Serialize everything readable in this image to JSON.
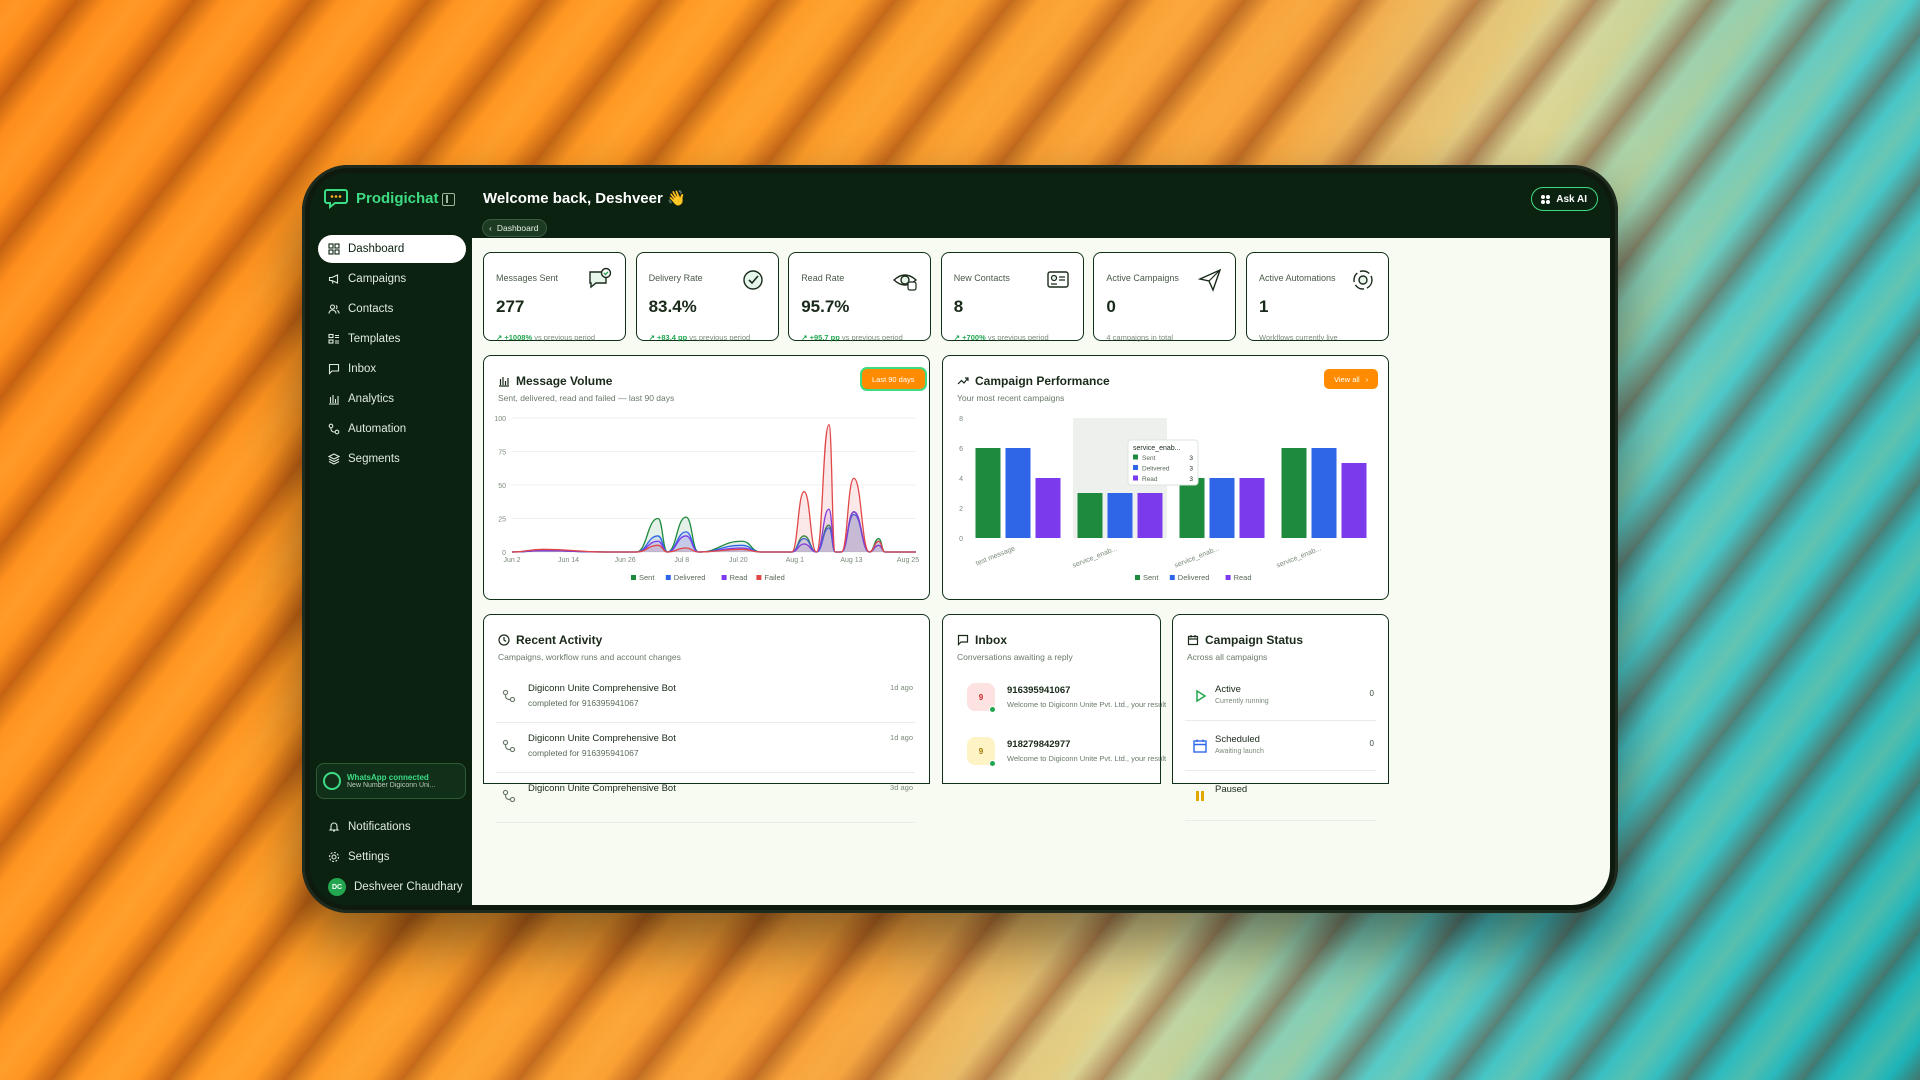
{
  "brand": {
    "name": "Prodigichat"
  },
  "header": {
    "welcome": "Welcome back, Deshveer",
    "wave": "👋",
    "ask_ai": "Ask AI"
  },
  "breadcrumb": {
    "label": "Dashboard"
  },
  "sidebar": {
    "items": [
      {
        "label": "Dashboard",
        "icon": "grid-icon",
        "active": true
      },
      {
        "label": "Campaigns",
        "icon": "megaphone-icon"
      },
      {
        "label": "Contacts",
        "icon": "users-icon"
      },
      {
        "label": "Templates",
        "icon": "template-icon"
      },
      {
        "label": "Inbox",
        "icon": "message-icon"
      },
      {
        "label": "Analytics",
        "icon": "bar-chart-icon"
      },
      {
        "label": "Automation",
        "icon": "workflow-icon"
      },
      {
        "label": "Segments",
        "icon": "layers-icon"
      }
    ],
    "whatsapp": {
      "title": "WhatsApp connected",
      "subtitle": "New Number Digiconn Uni..."
    },
    "notifications": "Notifications",
    "settings": "Settings",
    "user": {
      "name": "Deshveer Chaudhary",
      "initials": "DC"
    }
  },
  "kpis": [
    {
      "label": "Messages Sent",
      "value": "277",
      "delta": "+1008%",
      "suffix": "vs previous period",
      "icon": "message-check-icon"
    },
    {
      "label": "Delivery Rate",
      "value": "83.4%",
      "delta": "+83.4 pp",
      "suffix": "vs previous period",
      "icon": "check-circle-icon"
    },
    {
      "label": "Read Rate",
      "value": "95.7%",
      "delta": "+95.7 pp",
      "suffix": "vs previous period",
      "icon": "eye-icon"
    },
    {
      "label": "New Contacts",
      "value": "8",
      "delta": "+700%",
      "suffix": "vs previous period",
      "icon": "contact-card-icon"
    },
    {
      "label": "Active Campaigns",
      "value": "0",
      "delta": "",
      "suffix": "4 campaigns in total",
      "icon": "send-icon"
    },
    {
      "label": "Active Automations",
      "value": "1",
      "delta": "",
      "suffix": "Workflows currently live",
      "icon": "automation-icon"
    }
  ],
  "message_volume": {
    "title": "Message Volume",
    "subtitle": "Sent, delivered, read and failed — last 90 days",
    "range_button": "Last 90 days"
  },
  "campaign_performance": {
    "title": "Campaign Performance",
    "subtitle": "Your most recent campaigns",
    "view_all": "View all",
    "tooltip": {
      "title": "service_enab...",
      "rows": [
        {
          "name": "Sent",
          "value": "3"
        },
        {
          "name": "Delivered",
          "value": "3"
        },
        {
          "name": "Read",
          "value": "3"
        }
      ]
    }
  },
  "recent_activity": {
    "title": "Recent Activity",
    "subtitle": "Campaigns, workflow runs and account changes",
    "items": [
      {
        "title": "Digiconn Unite Comprehensive Bot",
        "desc": "completed for 916395941067",
        "time": "1d ago"
      },
      {
        "title": "Digiconn Unite Comprehensive Bot",
        "desc": "completed for 916395941067",
        "time": "1d ago"
      },
      {
        "title": "Digiconn Unite Comprehensive Bot",
        "desc": "",
        "time": "3d ago"
      }
    ]
  },
  "inbox": {
    "title": "Inbox",
    "subtitle": "Conversations awaiting a reply",
    "items": [
      {
        "number": "916395941067",
        "message": "Welcome to Digiconn Unite Pvt. Ltd., your result",
        "badge": "9",
        "bg": "#fde2e2",
        "fg": "#c62828"
      },
      {
        "number": "918279842977",
        "message": "Welcome to Digiconn Unite Pvt. Ltd., your result",
        "badge": "9",
        "bg": "#fdf3c4",
        "fg": "#a07800"
      }
    ]
  },
  "campaign_status": {
    "title": "Campaign Status",
    "subtitle": "Across all campaigns",
    "items": [
      {
        "title": "Active",
        "desc": "Currently running",
        "count": "0",
        "icon": "play-icon"
      },
      {
        "title": "Scheduled",
        "desc": "Awaiting launch",
        "count": "0",
        "icon": "calendar-icon"
      },
      {
        "title": "Paused",
        "desc": "",
        "count": "",
        "icon": "pause-icon"
      }
    ]
  },
  "colors": {
    "sent": "#1e8a3e",
    "delivered": "#2f66e8",
    "read": "#7c3aed",
    "failed": "#e04848",
    "accent": "#ff8c00",
    "brand": "#3ddc84"
  },
  "chart_data": [
    {
      "type": "line",
      "title": "Message Volume",
      "x_ticks": [
        "Jun 2",
        "Jun 14",
        "Jun 26",
        "Jul 8",
        "Jul 20",
        "Aug 1",
        "Aug 13",
        "Aug 25"
      ],
      "y_ticks": [
        "0",
        "25",
        "50",
        "75",
        "100"
      ],
      "ylim": [
        0,
        100
      ],
      "legend": [
        "Sent",
        "Delivered",
        "Read",
        "Failed"
      ],
      "series": [
        {
          "name": "Sent",
          "x_day": [
            0,
            10,
            30,
            40,
            47,
            50,
            56,
            60,
            74,
            80,
            90,
            94,
            98,
            102,
            104,
            106,
            110,
            115,
            118,
            120,
            130
          ],
          "values": [
            0,
            1,
            0,
            0,
            25,
            0,
            26,
            0,
            8,
            0,
            0,
            12,
            0,
            20,
            0,
            0,
            30,
            0,
            10,
            0,
            0
          ]
        },
        {
          "name": "Delivered",
          "x_day": [
            0,
            10,
            30,
            40,
            47,
            50,
            56,
            60,
            74,
            80,
            90,
            94,
            98,
            102,
            104,
            106,
            110,
            115,
            118,
            120,
            130
          ],
          "values": [
            0,
            1,
            0,
            0,
            12,
            0,
            15,
            0,
            5,
            0,
            0,
            10,
            0,
            18,
            0,
            0,
            28,
            0,
            8,
            0,
            0
          ]
        },
        {
          "name": "Read",
          "x_day": [
            0,
            10,
            30,
            40,
            47,
            50,
            56,
            60,
            74,
            80,
            90,
            94,
            98,
            102,
            104,
            106,
            110,
            115,
            118,
            120,
            130
          ],
          "values": [
            0,
            1,
            0,
            0,
            8,
            0,
            12,
            0,
            3,
            0,
            0,
            6,
            0,
            32,
            0,
            0,
            30,
            0,
            5,
            0,
            0
          ]
        },
        {
          "name": "Failed",
          "x_day": [
            0,
            10,
            30,
            40,
            47,
            50,
            56,
            60,
            74,
            80,
            90,
            94,
            98,
            102,
            104,
            106,
            110,
            115,
            118,
            120,
            130
          ],
          "values": [
            0,
            2,
            0,
            0,
            5,
            0,
            3,
            0,
            2,
            0,
            0,
            45,
            0,
            95,
            0,
            0,
            55,
            0,
            8,
            0,
            0
          ]
        }
      ]
    },
    {
      "type": "bar",
      "title": "Campaign Performance",
      "categories": [
        "test message",
        "service_enab...",
        "service_enab...",
        "service_enab..."
      ],
      "y_ticks": [
        "0",
        "2",
        "4",
        "6",
        "8"
      ],
      "ylim": [
        0,
        8
      ],
      "series": [
        {
          "name": "Sent",
          "values": [
            6,
            3,
            4,
            6
          ]
        },
        {
          "name": "Delivered",
          "values": [
            6,
            3,
            4,
            6
          ]
        },
        {
          "name": "Read",
          "values": [
            4,
            3,
            4,
            5
          ]
        }
      ]
    }
  ]
}
